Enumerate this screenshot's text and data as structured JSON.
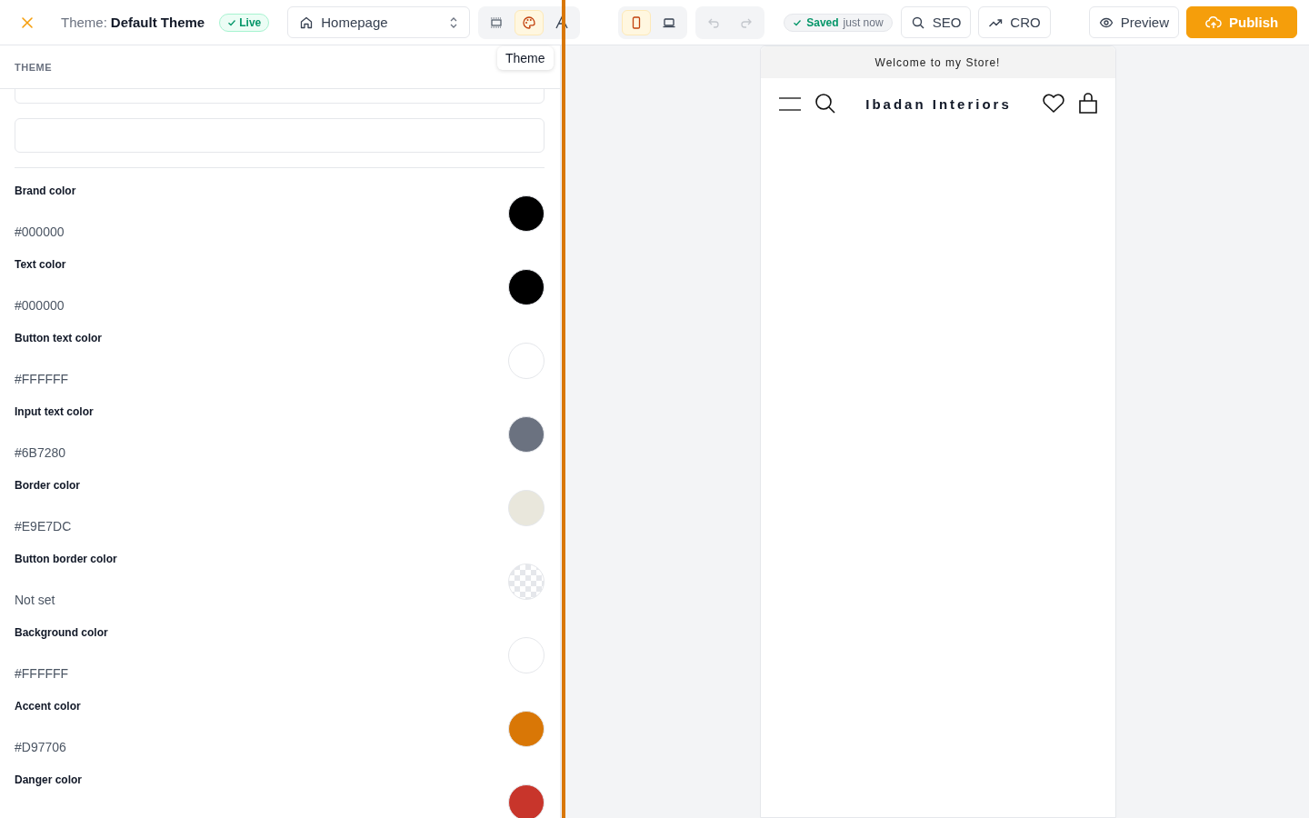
{
  "header": {
    "theme_label": "Theme:",
    "theme_name": "Default Theme",
    "status": "Live",
    "page_select": "Homepage",
    "tools": [
      {
        "kind": "layout",
        "selected": false
      },
      {
        "kind": "palette",
        "selected": true
      },
      {
        "kind": "text",
        "selected": false
      }
    ],
    "tooltip": "Theme",
    "devices": [
      {
        "kind": "mobile",
        "selected": true
      },
      {
        "kind": "desktop",
        "selected": false
      }
    ],
    "history": {
      "undo_disabled": true,
      "redo_disabled": true
    },
    "save_status": {
      "label": "Saved",
      "time": "just now"
    },
    "buttons": [
      {
        "kind": "seo",
        "label": "SEO"
      },
      {
        "kind": "cro",
        "label": "CRO"
      },
      {
        "kind": "preview",
        "label": "Preview"
      },
      {
        "kind": "publish",
        "label": "Publish"
      }
    ]
  },
  "panel": {
    "section_title": "THEME",
    "fields": [
      {
        "kind": "input"
      },
      {
        "kind": "input"
      }
    ],
    "colors": [
      {
        "label": "Brand color",
        "value": "#000000",
        "kind": "solid",
        "color": "#000000"
      },
      {
        "label": "Text color",
        "value": "#000000",
        "kind": "solid",
        "color": "#000000"
      },
      {
        "label": "Button text color",
        "value": "#FFFFFF",
        "kind": "solid",
        "color": "#ffffff"
      },
      {
        "label": "Input text color",
        "value": "#6B7280",
        "kind": "solid",
        "color": "#6b7280"
      },
      {
        "label": "Border color",
        "value": "#E9E7DC",
        "kind": "solid",
        "color": "#e9e7dc"
      },
      {
        "label": "Button border color",
        "value": "Not set",
        "kind": "unset"
      },
      {
        "label": "Background color",
        "value": "#FFFFFF",
        "kind": "solid",
        "color": "#ffffff"
      },
      {
        "label": "Accent color",
        "value": "#D97706",
        "kind": "solid",
        "color": "#d97706"
      },
      {
        "label": "Danger color",
        "kind": "solid",
        "color": "#c8352b"
      }
    ]
  },
  "preview": {
    "announcement": "Welcome to my Store!",
    "store_name": "Ibadan Interiors"
  }
}
